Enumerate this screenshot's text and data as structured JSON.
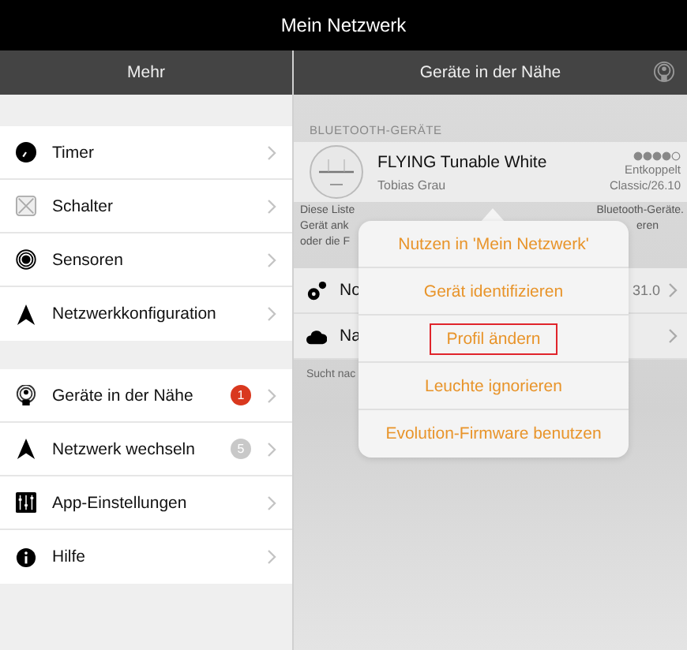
{
  "window": {
    "title": "Mein Netzwerk"
  },
  "left_header": {
    "title": "Mehr"
  },
  "right_header": {
    "title": "Geräte in der Nähe"
  },
  "menu_groups": [
    [
      {
        "label": "Timer",
        "kind": "clock"
      },
      {
        "label": "Schalter",
        "kind": "switch"
      },
      {
        "label": "Sensoren",
        "kind": "sensor"
      },
      {
        "label": "Netzwerkkonfiguration",
        "kind": "network"
      }
    ],
    [
      {
        "label": "Geräte in der Nähe",
        "kind": "nearby",
        "badge": "1",
        "color": "#d9381e"
      },
      {
        "label": "Netzwerk wechseln",
        "kind": "network",
        "badge": "5",
        "color": "#c8c8c8"
      },
      {
        "label": "App-Einstellungen",
        "kind": "sliders"
      },
      {
        "label": "Hilfe",
        "kind": "info"
      }
    ]
  ],
  "section_header": "BLUETOOTH-GERÄTE",
  "device": {
    "name": "FLYING Tunable White",
    "vendor": "Tobias Grau",
    "status": "Entkoppelt",
    "version": "Classic/26.10"
  },
  "footer_lines": [
    {
      "left": "Diese Liste",
      "right": "Bluetooth-Geräte."
    },
    {
      "left": "Gerät ank",
      "right": "eren"
    },
    {
      "left": "oder die F"
    }
  ],
  "rows": [
    {
      "label": "No",
      "kind": "gears",
      "value": "31.0"
    },
    {
      "label": "Na",
      "kind": "cloud"
    }
  ],
  "searching": "Sucht nac",
  "popover": [
    {
      "label": "Nutzen in 'Mein Netzwerk'",
      "highlighted": false
    },
    {
      "label": "Gerät identifizieren",
      "highlighted": false
    },
    {
      "label": "Profil ändern",
      "highlighted": true
    },
    {
      "label": "Leuchte ignorieren",
      "highlighted": false
    },
    {
      "label": "Evolution-Firmware benutzen",
      "highlighted": false
    }
  ]
}
